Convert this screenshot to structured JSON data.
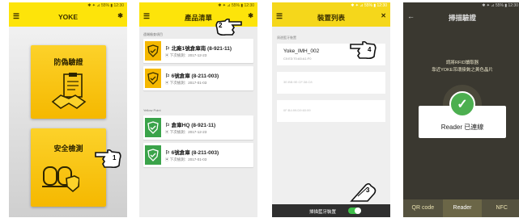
{
  "colors": {
    "brand_yellow": "#fde40a",
    "card_yellow": "#f5b800",
    "green": "#3aa34a"
  },
  "screen1": {
    "status": "✱ ✦ ⊿ 55% ▮ 12:30",
    "title": "YOKE",
    "menu_icon": "hamburger-icon",
    "right_icon": "bluetooth-icon",
    "card_top": "防偽驗證",
    "card_bottom": "安全檢測",
    "callout": "1"
  },
  "screen2": {
    "status": "✱ ✦ ⊿ 55% ▮ 12:30",
    "title": "產品清單",
    "callout": "2",
    "section1": "遠端檢查項目",
    "section2": "Yellow Point",
    "items": [
      {
        "name": "⚐ 北廠1號倉庫南 (8-921-11)",
        "date": "▣ 下次檢測：2017-12-23",
        "status": "yellow"
      },
      {
        "name": "⚐ 6號倉庫 (8-211-003)",
        "date": "▣ 下次檢測：2017-01-03",
        "status": "yellow"
      },
      {
        "name": "⚐ 倉庫HQ (8-921-11)",
        "date": "▣ 下次檢測：2017-12-23",
        "status": "green"
      },
      {
        "name": "⚐ 6號倉庫 (8-211-003)",
        "date": "▣ 下次檢測：2017-01-03",
        "status": "green"
      }
    ]
  },
  "screen3": {
    "status": "✱ ✦ ⊿ 55% ▮ 12:30",
    "title": "裝置列表",
    "section": "周邊藍牙裝置",
    "callout_top": "4",
    "callout_bottom": "3",
    "devices": [
      {
        "name": "Yoke_IMH_002",
        "mac": "C0:E3:70:A5:A1:F0"
      },
      {
        "name": "",
        "mac": "3E:BB:9E:CF:38:C8"
      },
      {
        "name": "",
        "mac": "0F:B4:99:D9:60:99"
      }
    ],
    "scan_label": "掃描藍牙裝置",
    "scan_on": true
  },
  "screen4": {
    "status": "✱ ✦ ⊿ 55% ▮ 12:30",
    "title": "掃描驗證",
    "hint_line1": "請將RFID讀取器",
    "hint_line2": "靠近YOKE吊環掛鉤之黃色晶片",
    "dialog_text": "Reader 已連線",
    "tabs": [
      "QR code",
      "Reader",
      "NFC"
    ],
    "active_tab": 1
  }
}
